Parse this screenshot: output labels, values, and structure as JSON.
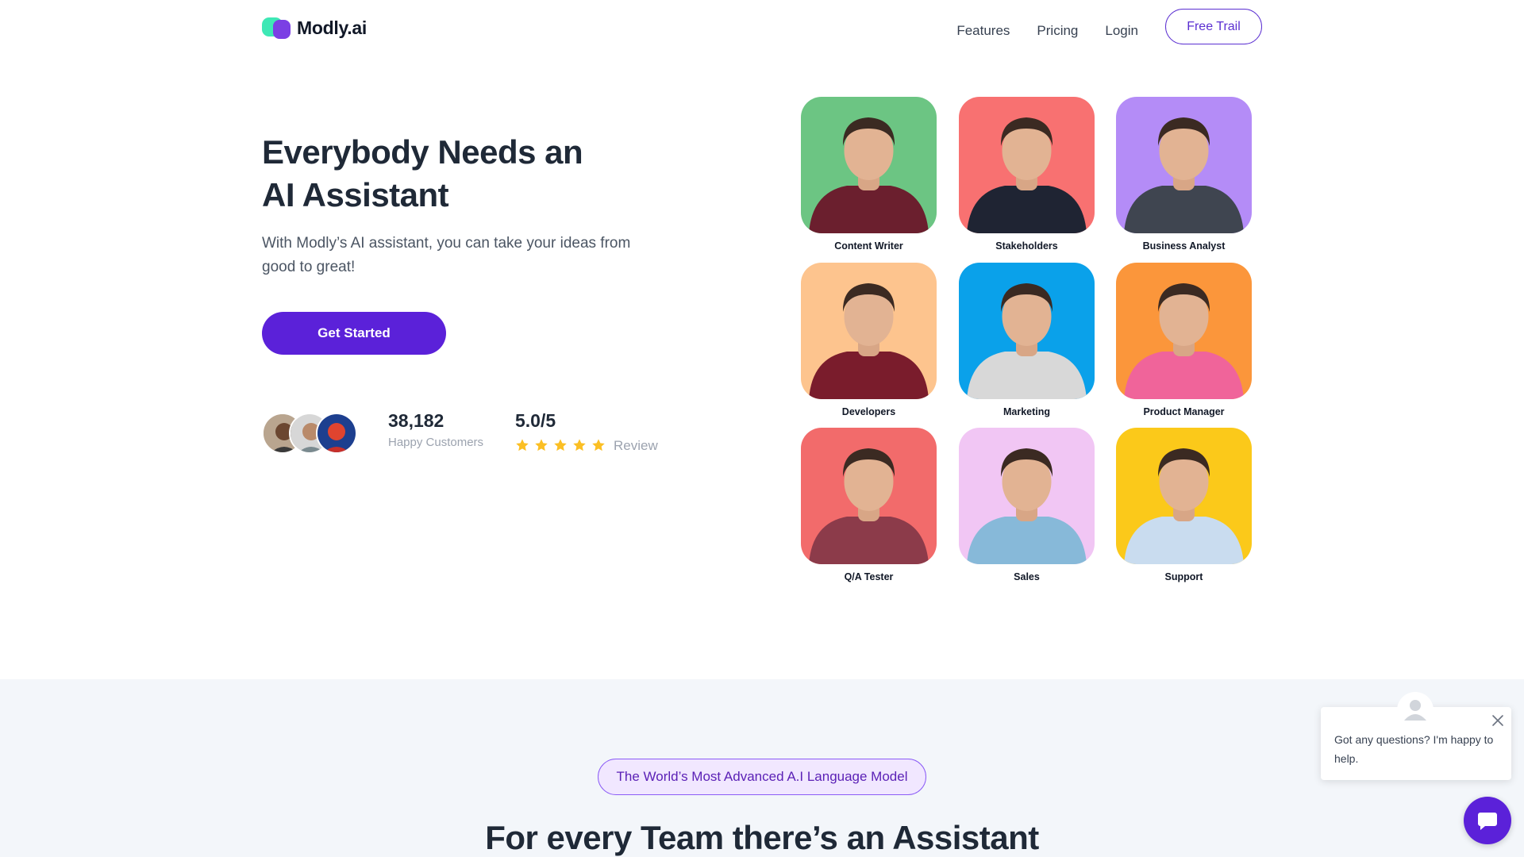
{
  "nav": {
    "brand": "Modly.ai",
    "links": [
      "Features",
      "Pricing",
      "Login"
    ],
    "cta": "Free Trail"
  },
  "hero": {
    "title_line1": "Everybody Needs an",
    "title_line2": "AI Assistant",
    "subtitle": "With Modly’s AI assistant, you can take your ideas from good to great!",
    "cta": "Get Started",
    "customers_count": "38,182",
    "customers_label": "Happy Customers",
    "rating": "5.0/5",
    "rating_stars": 5,
    "rating_label": "Review"
  },
  "roles": [
    {
      "label": "Content Writer",
      "bg": "#6cc583",
      "shirt": "#6b1f2e"
    },
    {
      "label": "Stakeholders",
      "bg": "#f87171",
      "shirt": "#1f2433"
    },
    {
      "label": "Business Analyst",
      "bg": "#b48cf7",
      "shirt": "#3f4550"
    },
    {
      "label": "Developers",
      "bg": "#fdc48e",
      "shirt": "#7a1c2c"
    },
    {
      "label": "Marketing",
      "bg": "#0aa1ea",
      "shirt": "#d8d8d8"
    },
    {
      "label": "Product Manager",
      "bg": "#fb963b",
      "shirt": "#f0649a"
    },
    {
      "label": "Q/A Tester",
      "bg": "#f26b6b",
      "shirt": "#8c3b4a"
    },
    {
      "label": "Sales",
      "bg": "#f1c6f4",
      "shirt": "#87b9d9"
    },
    {
      "label": "Support",
      "bg": "#fbc91a",
      "shirt": "#c9dcef"
    }
  ],
  "section2": {
    "badge": "The World’s Most Advanced A.I Language Model",
    "title": "For every Team there’s an Assistant"
  },
  "chat": {
    "message": "Got any questions? I'm happy to help."
  },
  "colors": {
    "brand_purple": "#5b21d9",
    "brand_green": "#3ee8b5",
    "star": "#fbbf24"
  },
  "icons": {
    "close": "close-icon",
    "chat": "chat-bubble-icon",
    "star": "star-icon"
  }
}
